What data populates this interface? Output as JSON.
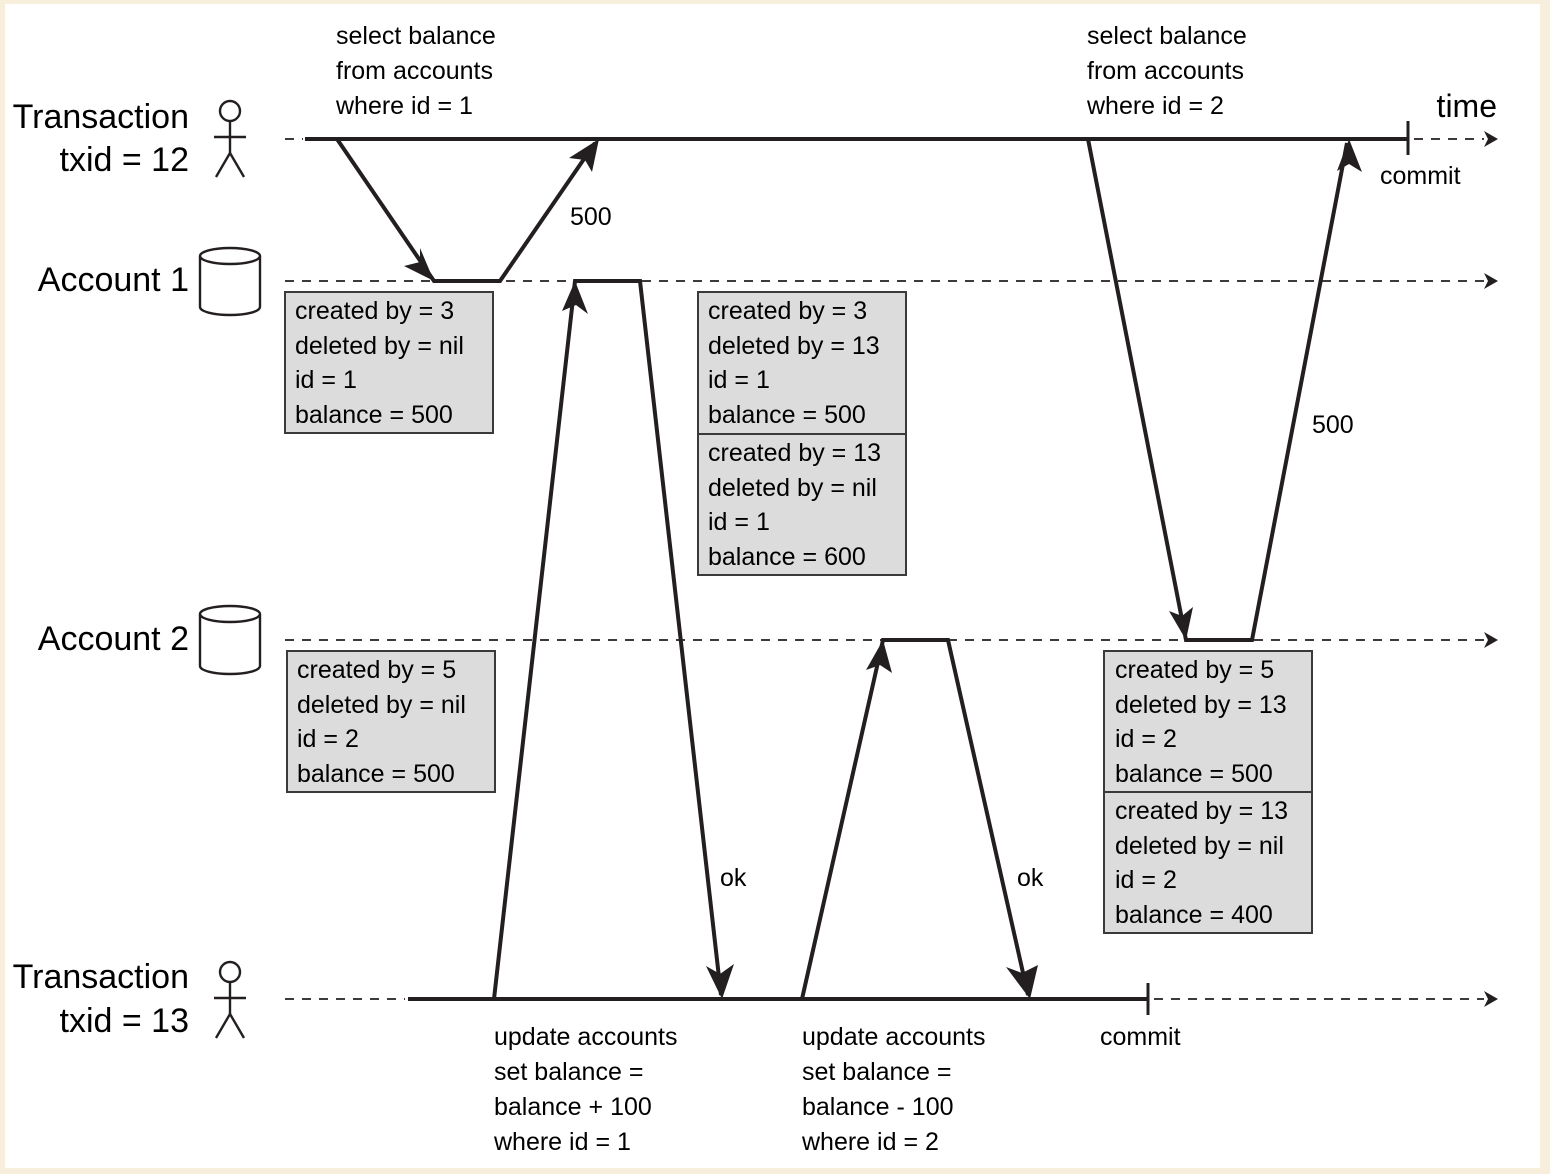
{
  "diagram": {
    "time_label": "time",
    "lanes": {
      "tx12": {
        "line1": "Transaction",
        "line2": "txid = 12",
        "icon": "person-icon"
      },
      "acct1": {
        "label": "Account 1",
        "icon": "database-cylinder-icon"
      },
      "acct2": {
        "label": "Account 2",
        "icon": "database-cylinder-icon"
      },
      "tx13": {
        "line1": "Transaction",
        "line2": "txid = 13",
        "icon": "person-icon"
      }
    },
    "queries": {
      "tx12_q1": [
        "select balance",
        "from accounts",
        "where id = 1"
      ],
      "tx12_q2": [
        "select balance",
        "from accounts",
        "where id = 2"
      ],
      "tx13_q1": [
        "update accounts",
        "set balance =",
        "balance + 100",
        "where id = 1"
      ],
      "tx13_q2": [
        "update accounts",
        "set balance =",
        "balance - 100",
        "where id = 2"
      ]
    },
    "responses": {
      "tx12_r1": "500",
      "tx12_r2": "500",
      "tx13_r1": "ok",
      "tx13_r2": "ok"
    },
    "commits": {
      "tx12": "commit",
      "tx13": "commit"
    },
    "record_boxes": {
      "acct1_before": [
        [
          "created by = 3",
          "deleted by = nil",
          "id = 1",
          "balance = 500"
        ]
      ],
      "acct1_after": [
        [
          "created by = 3",
          "deleted by = 13",
          "id = 1",
          "balance = 500"
        ],
        [
          "created by = 13",
          "deleted by = nil",
          "id = 1",
          "balance = 600"
        ]
      ],
      "acct2_before": [
        [
          "created by = 5",
          "deleted by = nil",
          "id = 2",
          "balance = 500"
        ]
      ],
      "acct2_after": [
        [
          "created by = 5",
          "deleted by = 13",
          "id = 2",
          "balance = 500"
        ],
        [
          "created by = 13",
          "deleted by = nil",
          "id = 2",
          "balance = 400"
        ]
      ]
    }
  }
}
